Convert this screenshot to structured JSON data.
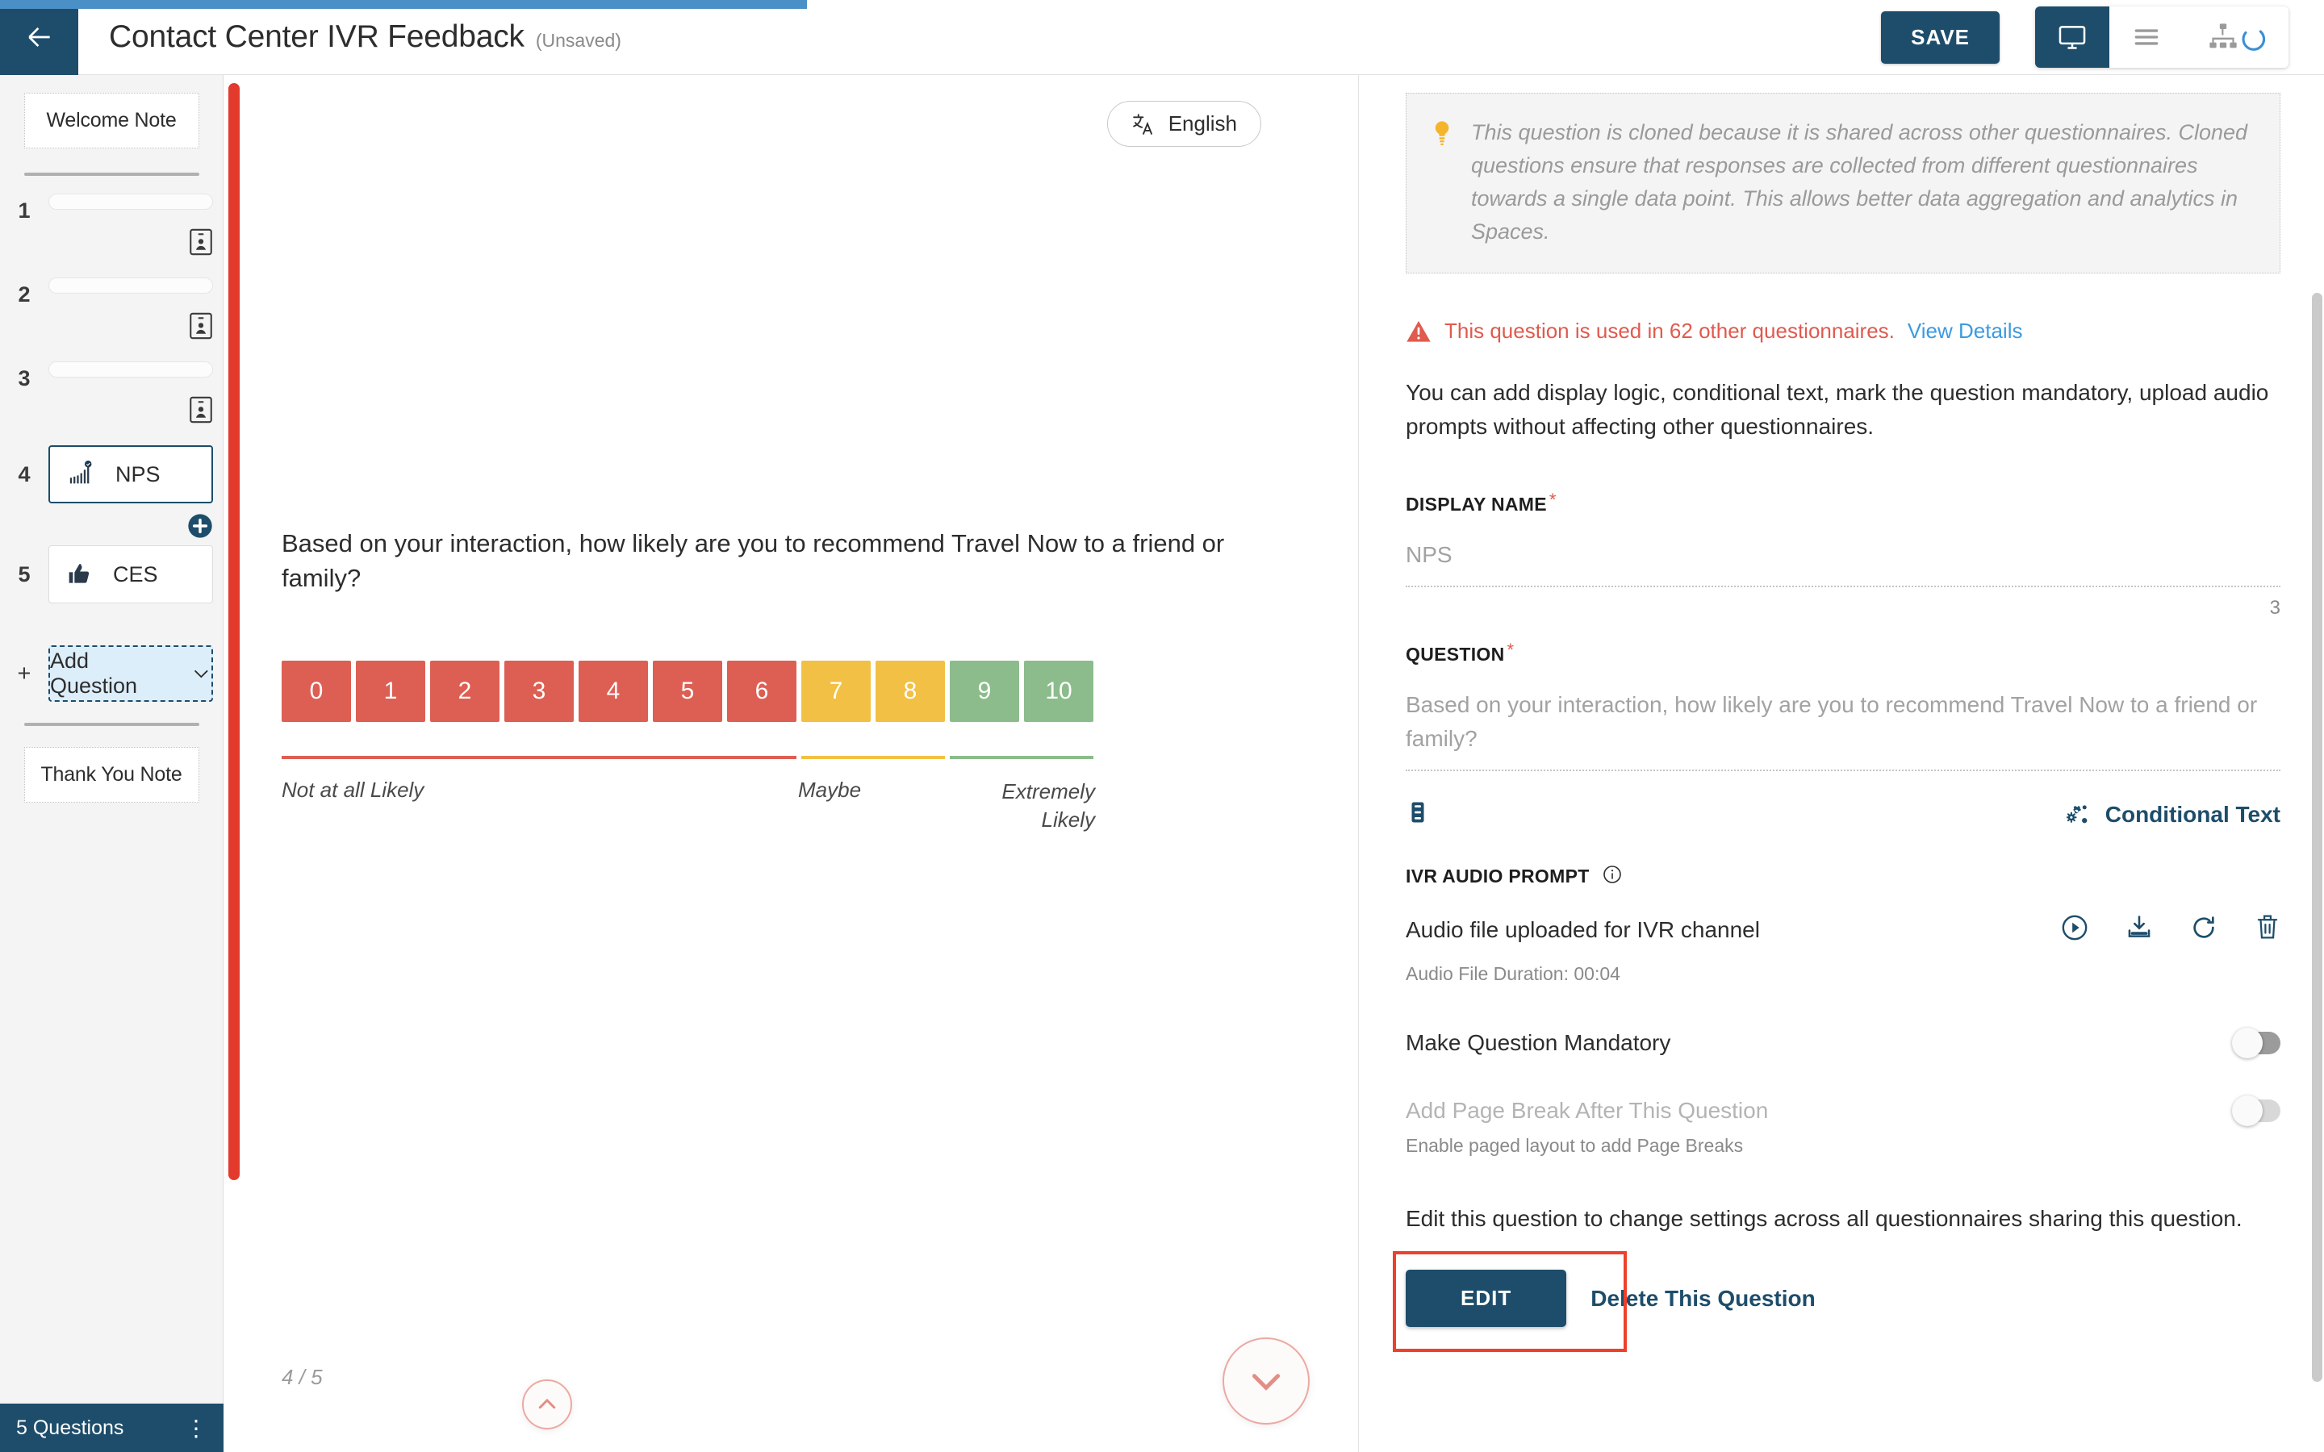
{
  "header": {
    "back_icon": "arrow-left-icon",
    "title": "Contact Center IVR Feedback",
    "unsaved": "(Unsaved)",
    "save_label": "SAVE",
    "desktop_icon": "monitor-icon",
    "menu_icon": "hamburger-menu-icon",
    "sitemap_icon": "sitemap-icon",
    "spinner_icon": "loading-spinner-icon",
    "accent_color": "#1d4d6b",
    "progress_color": "#4a90c7"
  },
  "sidebar": {
    "welcome_note": "Welcome Note",
    "thank_you_note": "Thank You Note",
    "placeholder_items": [
      {
        "number": "1",
        "icon": "contact-card-icon"
      },
      {
        "number": "2",
        "icon": "contact-card-icon"
      },
      {
        "number": "3",
        "icon": "contact-card-icon"
      }
    ],
    "questions": [
      {
        "number": "4",
        "label": "NPS",
        "icon": "nps-chart-icon",
        "selected": true
      },
      {
        "number": "5",
        "label": "CES",
        "icon": "thumbs-up-icon",
        "selected": false
      }
    ],
    "add_plus_icon": "plus-circle-icon",
    "add_question_label": "Add Question",
    "add_question_number": "+",
    "add_chevron_icon": "chevron-down-icon",
    "footer_label": "5 Questions",
    "footer_menu_icon": "kebab-menu-icon",
    "scrollbar_color": "#e23b2e"
  },
  "preview": {
    "language_icon": "translate-icon",
    "language_label": "English",
    "question_text": "Based on your interaction, how likely are you to recommend Travel Now to a friend or family?",
    "page_indicator": "4 / 5",
    "prev_icon": "chevron-up-icon",
    "next_icon": "chevron-down-icon"
  },
  "nps": {
    "values": [
      "0",
      "1",
      "2",
      "3",
      "4",
      "5",
      "6",
      "7",
      "8",
      "9",
      "10"
    ],
    "colors": [
      "#dd5f53",
      "#dd5f53",
      "#dd5f53",
      "#dd5f53",
      "#dd5f53",
      "#dd5f53",
      "#dd5f53",
      "#f2c044",
      "#f2c044",
      "#8cbc8b",
      "#8cbc8b"
    ],
    "detractor_color": "#dd5f53",
    "passive_color": "#f2c044",
    "promoter_color": "#8cbc8b",
    "label_low": "Not at all Likely",
    "label_mid": "Maybe",
    "label_high": "Extremely Likely"
  },
  "panel": {
    "info_icon": "lightbulb-icon",
    "info_text": "This question is cloned because it is shared across other questionnaires. Cloned questions ensure that responses are collected from different questionnaires towards a single data point. This allows better data aggregation and analytics in Spaces.",
    "warning_icon": "warning-triangle-icon",
    "warning_text": "This question is used in 62 other questionnaires.",
    "warning_link": "View Details",
    "description": "You can add display logic, conditional text, mark the question mandatory, upload audio prompts without affecting other questionnaires.",
    "display_name_label": "DISPLAY NAME",
    "display_name_value": "NPS",
    "display_name_count": "3",
    "question_label": "QUESTION",
    "question_value": "Based on your interaction, how likely are you to recommend Travel Now to a friend or family?",
    "piping_icon": "piping-text-icon",
    "conditional_icon": "gears-icon",
    "conditional_text_label": "Conditional Text",
    "ivr_label": "IVR AUDIO PROMPT",
    "ivr_info_icon": "info-circle-icon",
    "audio_file_text": "Audio file uploaded for IVR channel",
    "audio_play_icon": "play-circle-icon",
    "audio_download_icon": "download-icon",
    "audio_refresh_icon": "refresh-icon",
    "audio_delete_icon": "trash-icon",
    "audio_duration": "Audio File Duration: 00:04",
    "mandatory_label": "Make Question Mandatory",
    "mandatory_on": false,
    "pagebreak_label": "Add Page Break After This Question",
    "pagebreak_hint": "Enable paged layout to add Page Breaks",
    "pagebreak_on": false,
    "edit_desc": "Edit this question to change settings across all questionnaires sharing this question.",
    "edit_label": "EDIT",
    "delete_label": "Delete This Question",
    "highlight_color": "#ee402a",
    "required_marker": "*"
  }
}
